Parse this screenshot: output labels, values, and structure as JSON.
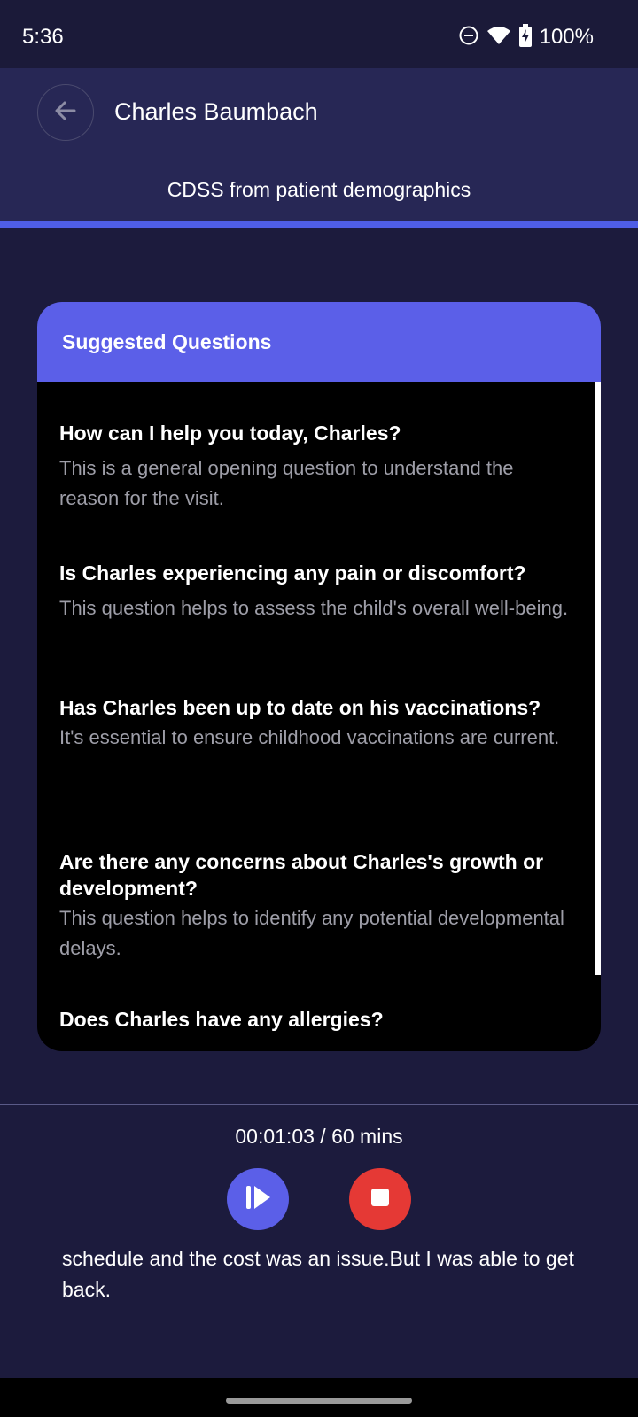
{
  "status_bar": {
    "time": "5:36",
    "battery": "100%",
    "icons": [
      "do-not-disturb-icon",
      "wifi-icon",
      "battery-charging-icon"
    ]
  },
  "header": {
    "patient_name": "Charles Baumbach",
    "subtitle": "CDSS from patient demographics",
    "back_icon": "arrow-left-icon"
  },
  "card": {
    "title": "Suggested Questions",
    "questions": [
      {
        "title": "How can I help you today, Charles?",
        "description": "This is a general opening question to understand the reason for the visit."
      },
      {
        "title": "Is Charles experiencing any pain or discomfort?",
        "description": "This question helps to assess the child's overall well-being."
      },
      {
        "title": "Has Charles been up to date on his vaccinations?",
        "description": "It's essential to ensure childhood vaccinations are current."
      },
      {
        "title": "Are there any concerns about Charles's growth or development?",
        "description": "This question helps to identify any potential developmental delays."
      },
      {
        "title": "Does Charles have any allergies?",
        "description": ""
      }
    ]
  },
  "recording": {
    "timer": "00:01:03 / 60 mins",
    "play_icon": "play-pause-icon",
    "stop_icon": "stop-icon",
    "transcript": "schedule and the cost was an issue.But I was able to get back."
  },
  "colors": {
    "background": "#1c1b3d",
    "header": "#272755",
    "accent": "#5b5fe8",
    "stop": "#e53935"
  }
}
